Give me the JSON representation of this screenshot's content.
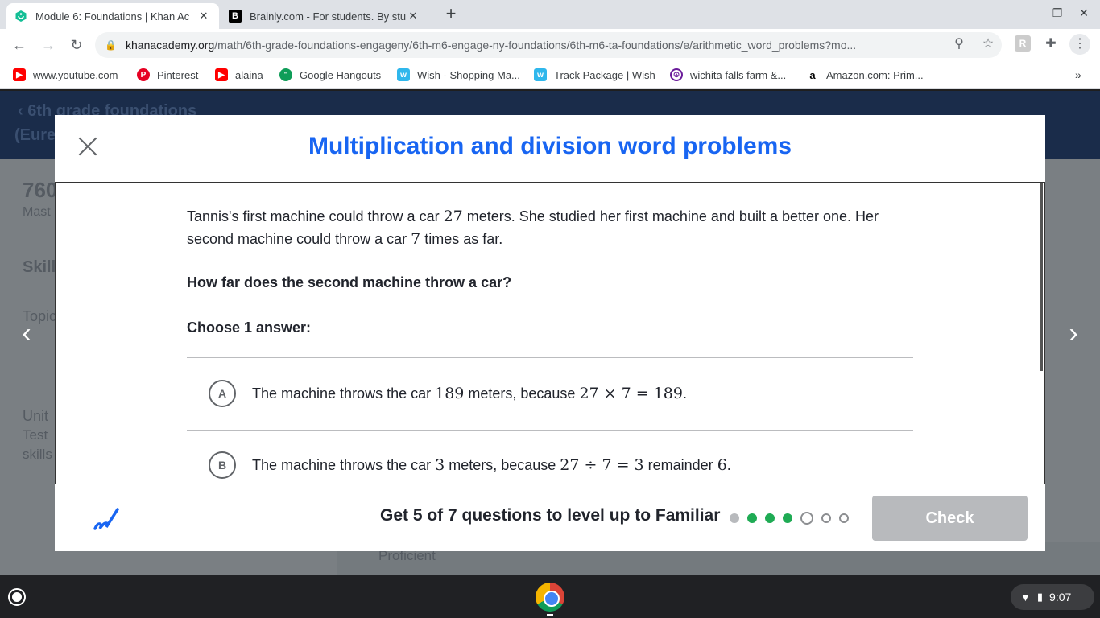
{
  "browser": {
    "tabs": [
      {
        "title": "Module 6: Foundations | Khan Ac",
        "active": true
      },
      {
        "title": "Brainly.com - For students. By stu",
        "active": false
      }
    ],
    "url_host": "khanacademy.org",
    "url_path": "/math/6th-grade-foundations-engageny/6th-m6-engage-ny-foundations/6th-m6-ta-foundations/e/arithmetic_word_problems?mo...",
    "bookmarks": [
      {
        "label": "www.youtube.com",
        "color": "#ff0000"
      },
      {
        "label": "Pinterest",
        "color": "#e60023"
      },
      {
        "label": "alaina",
        "color": "#ff0000"
      },
      {
        "label": "Google Hangouts",
        "color": "#0f9d58"
      },
      {
        "label": "Wish - Shopping Ma...",
        "color": "#2fb7ec"
      },
      {
        "label": "Track Package | Wish",
        "color": "#2fb7ec"
      },
      {
        "label": "wichita falls farm &...",
        "color": "#6a1b9a"
      },
      {
        "label": "Amazon.com: Prim...",
        "color": "#000000"
      }
    ],
    "bookmarks_overflow": "»"
  },
  "underlay": {
    "breadcrumb_line1": "6th grade foundations",
    "breadcrumb_line2": "(Eure",
    "points": "760",
    "mastery": "Mast",
    "skills": "Skill",
    "topic": "Topic",
    "unit": "Unit",
    "test": "Test",
    "skills2": "skills",
    "proficient": "Proficient"
  },
  "modal": {
    "title": "Multiplication and division word problems",
    "question": {
      "p1_a": "Tannis's first machine could throw a car ",
      "p1_n1": "27",
      "p1_b": " meters. She studied her first machine and built a better one. Her second machine could throw a car ",
      "p1_n2": "7",
      "p1_c": " times as far.",
      "ask": "How far does the second machine throw a car?",
      "choose": "Choose 1 answer:"
    },
    "choices": [
      {
        "letter": "A",
        "pre": "The machine throws the car ",
        "num": "189",
        "mid": " meters, because ",
        "math": "27 × 7 = 189",
        "post": "."
      },
      {
        "letter": "B",
        "pre": "The machine throws the car ",
        "num": "3",
        "mid": " meters, because ",
        "math": "27 ÷ 7 = 3",
        "post": " remainder ",
        "post_num": "6",
        "end": "."
      }
    ],
    "footer": {
      "progress": "Get 5 of 7 questions to level up to Familiar",
      "dots": [
        "gray",
        "green",
        "green",
        "green",
        "current",
        "empty",
        "empty"
      ],
      "check": "Check"
    }
  },
  "shelf": {
    "time": "9:07"
  },
  "colors": {
    "accent": "#1865f2",
    "correct": "#1fab54",
    "disabled": "#b8babd"
  }
}
